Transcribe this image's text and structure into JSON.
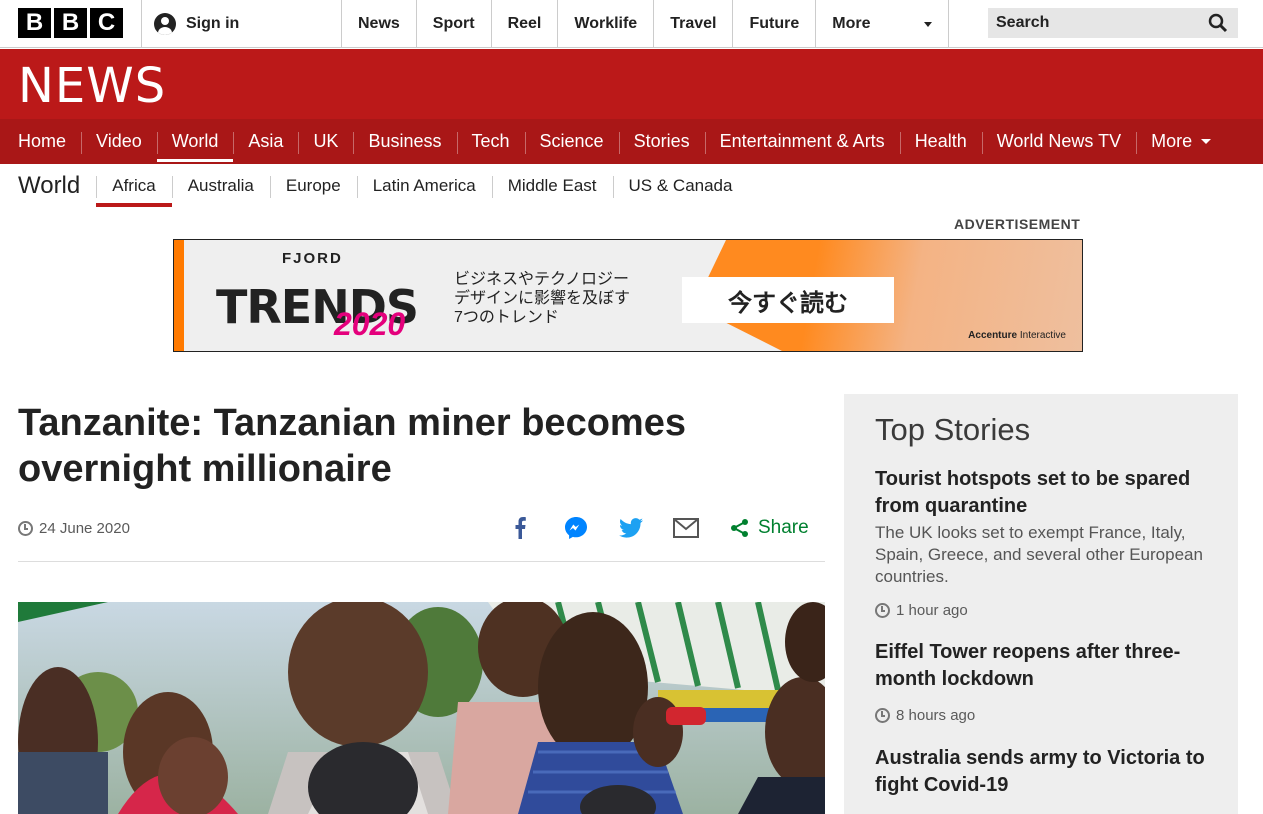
{
  "topbar": {
    "logo_letters": [
      "B",
      "B",
      "C"
    ],
    "signin_label": "Sign in",
    "nav": [
      "News",
      "Sport",
      "Reel",
      "Worklife",
      "Travel",
      "Future"
    ],
    "more_label": "More",
    "search_placeholder": "Search"
  },
  "header": {
    "logo": "NEWS",
    "brand_color": "#bb1919"
  },
  "main_nav": {
    "items": [
      "Home",
      "Video",
      "World",
      "Asia",
      "UK",
      "Business",
      "Tech",
      "Science",
      "Stories",
      "Entertainment & Arts",
      "Health",
      "World News TV"
    ],
    "more_label": "More",
    "active": "World"
  },
  "sub_nav": {
    "section": "World",
    "items": [
      "Africa",
      "Australia",
      "Europe",
      "Latin America",
      "Middle East",
      "US & Canada"
    ],
    "active": "Africa"
  },
  "advertisement": {
    "label": "ADVERTISEMENT",
    "fjord": "FJORD",
    "trends": "TRENDS",
    "year": "2020",
    "jp_lines": [
      "ビジネスやテクノロジー",
      "デザインに影響を及ぼす",
      "7つのトレンド"
    ],
    "cta": "今すぐ読む",
    "brand_bold": "Accenture",
    "brand_rest": " Interactive"
  },
  "article": {
    "headline": "Tanzanite: Tanzanian miner becomes overnight millionaire",
    "date": "24 June 2020",
    "share_label": "Share",
    "share_icons": [
      "facebook-icon",
      "messenger-icon",
      "twitter-icon",
      "email-icon",
      "share-icon"
    ]
  },
  "sidebar": {
    "title": "Top Stories",
    "stories": [
      {
        "headline": "Tourist hotspots set to be spared from quarantine",
        "summary": "The UK looks set to exempt France, Italy, Spain, Greece, and several other European countries.",
        "time": "1 hour ago"
      },
      {
        "headline": "Eiffel Tower reopens after three-month lockdown",
        "time": "8 hours ago"
      },
      {
        "headline": "Australia sends army to Victoria to fight Covid-19"
      }
    ]
  }
}
